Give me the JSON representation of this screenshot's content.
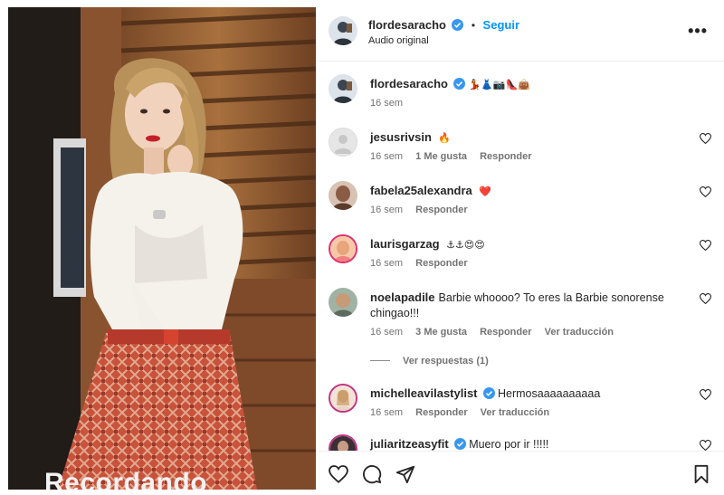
{
  "post": {
    "username": "flordesaracho",
    "follow_label": "Seguir",
    "follow_separator": "•",
    "audio_label": "Audio original",
    "more_label": "•••",
    "caption_emojis": "💃👗📷👠👜",
    "caption_time": "16 sem",
    "media_overlay_text": "Recordando"
  },
  "comments": [
    {
      "username": "jesusrivsin",
      "text": "",
      "emoji": "🔥",
      "time": "16 sem",
      "likes": "1 Me gusta",
      "reply": "Responder",
      "translate": "",
      "verified": false
    },
    {
      "username": "fabela25alexandra",
      "text": "",
      "emoji": "❤️",
      "time": "16 sem",
      "likes": "",
      "reply": "Responder",
      "translate": "",
      "verified": false
    },
    {
      "username": "laurisgarzag",
      "text": "",
      "emoji": "⚓⚓😍😍",
      "time": "16 sem",
      "likes": "",
      "reply": "Responder",
      "translate": "",
      "verified": false
    },
    {
      "username": "noelapadile",
      "text": "Barbie whoooo? To eres la Barbie sonorense chingao!!!",
      "emoji": "",
      "time": "16 sem",
      "likes": "3 Me gusta",
      "reply": "Responder",
      "translate": "Ver traducción",
      "verified": false,
      "view_replies": "Ver respuestas (1)"
    },
    {
      "username": "michelleavilastylist",
      "text": "Hermosaaaaaaaaaa",
      "emoji": "",
      "time": "16 sem",
      "likes": "",
      "reply": "Responder",
      "translate": "Ver traducción",
      "verified": true
    },
    {
      "username": "juliaritzeasyfit",
      "text": "Muero por ir !!!!!",
      "emoji": "",
      "time": "",
      "likes": "",
      "reply": "",
      "translate": "",
      "verified": true
    }
  ],
  "colors": {
    "link_blue": "#0095f6",
    "verified_blue": "#3897f0",
    "text_primary": "#262626",
    "text_secondary": "#737373"
  },
  "icons": {
    "like": "heart-icon",
    "comment": "comment-icon",
    "share": "share-icon",
    "save": "bookmark-icon",
    "more": "more-options-icon",
    "verified": "verified-badge-icon"
  }
}
